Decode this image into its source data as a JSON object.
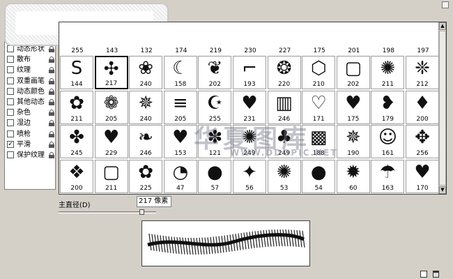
{
  "options_panel": {
    "items": [
      {
        "label": "动态形状",
        "checked": false
      },
      {
        "label": "散布",
        "checked": false
      },
      {
        "label": "纹理",
        "checked": false
      },
      {
        "label": "双重画笔",
        "checked": false
      },
      {
        "label": "动态颜色",
        "checked": false
      },
      {
        "label": "其他动态",
        "checked": false
      },
      {
        "label": "杂色",
        "checked": false
      },
      {
        "label": "湿边",
        "checked": false
      },
      {
        "label": "喷枪",
        "checked": false
      },
      {
        "label": "平滑",
        "checked": true
      },
      {
        "label": "保护纹理",
        "checked": false
      }
    ],
    "check_mark": "✓"
  },
  "brush_grid": {
    "top_row_labels": [
      "255",
      "143",
      "132",
      "174",
      "219",
      "230",
      "227",
      "175",
      "201",
      "198",
      "197"
    ],
    "rows": [
      [
        {
          "glyph": "S",
          "size": "144"
        },
        {
          "glyph": "✣",
          "size": "217",
          "selected": true
        },
        {
          "glyph": "❀",
          "size": "240"
        },
        {
          "glyph": "☾",
          "size": "158"
        },
        {
          "glyph": "❦",
          "size": "202"
        },
        {
          "glyph": "⌐",
          "size": "193"
        },
        {
          "glyph": "❂",
          "size": "220"
        },
        {
          "glyph": "⬡",
          "size": "210"
        },
        {
          "glyph": "▢",
          "size": "202"
        },
        {
          "glyph": "✺",
          "size": "211"
        },
        {
          "glyph": "❈",
          "size": "212"
        }
      ],
      [
        {
          "glyph": "✿",
          "size": "211"
        },
        {
          "glyph": "❁",
          "size": "205"
        },
        {
          "glyph": "✵",
          "size": "240"
        },
        {
          "glyph": "≡",
          "size": "205"
        },
        {
          "glyph": "☪",
          "size": "255"
        },
        {
          "glyph": "♥",
          "size": "231"
        },
        {
          "glyph": "▥",
          "size": "246"
        },
        {
          "glyph": "♡",
          "size": "171"
        },
        {
          "glyph": "♥",
          "size": "175"
        },
        {
          "glyph": "❥",
          "size": "179"
        },
        {
          "glyph": "♦",
          "size": "200"
        }
      ],
      [
        {
          "glyph": "✤",
          "size": "245"
        },
        {
          "glyph": "♥",
          "size": "229"
        },
        {
          "glyph": "❧",
          "size": "246"
        },
        {
          "glyph": "♥",
          "size": "153"
        },
        {
          "glyph": "✽",
          "size": "121"
        },
        {
          "glyph": "✺",
          "size": "249"
        },
        {
          "glyph": "♣",
          "size": "249"
        },
        {
          "glyph": "▩",
          "size": "188"
        },
        {
          "glyph": "✵",
          "size": "190"
        },
        {
          "glyph": "☺",
          "size": "161"
        },
        {
          "glyph": "✥",
          "size": "256"
        }
      ],
      [
        {
          "glyph": "❖",
          "size": "200"
        },
        {
          "glyph": "▢",
          "size": "211"
        },
        {
          "glyph": "✿",
          "size": "225"
        },
        {
          "glyph": "◔",
          "size": "47"
        },
        {
          "glyph": "●",
          "size": "57"
        },
        {
          "glyph": "✦",
          "size": "56"
        },
        {
          "glyph": "✺",
          "size": "53"
        },
        {
          "glyph": "●",
          "size": "54"
        },
        {
          "glyph": "✹",
          "size": "60"
        },
        {
          "glyph": "☂",
          "size": "163"
        },
        {
          "glyph": "♥",
          "size": "170"
        }
      ]
    ],
    "scroll_up": "▲",
    "scroll_down": "▼"
  },
  "diameter": {
    "label": "主直径(D)",
    "value": "217 像素",
    "slider_fraction": 0.85
  },
  "watermark": {
    "text": "华夏图库",
    "url": "WWW.DDOPIC.NET"
  },
  "colors": {
    "panel_bg": "#d4d0c8",
    "grid_bg": "#ffffff"
  }
}
